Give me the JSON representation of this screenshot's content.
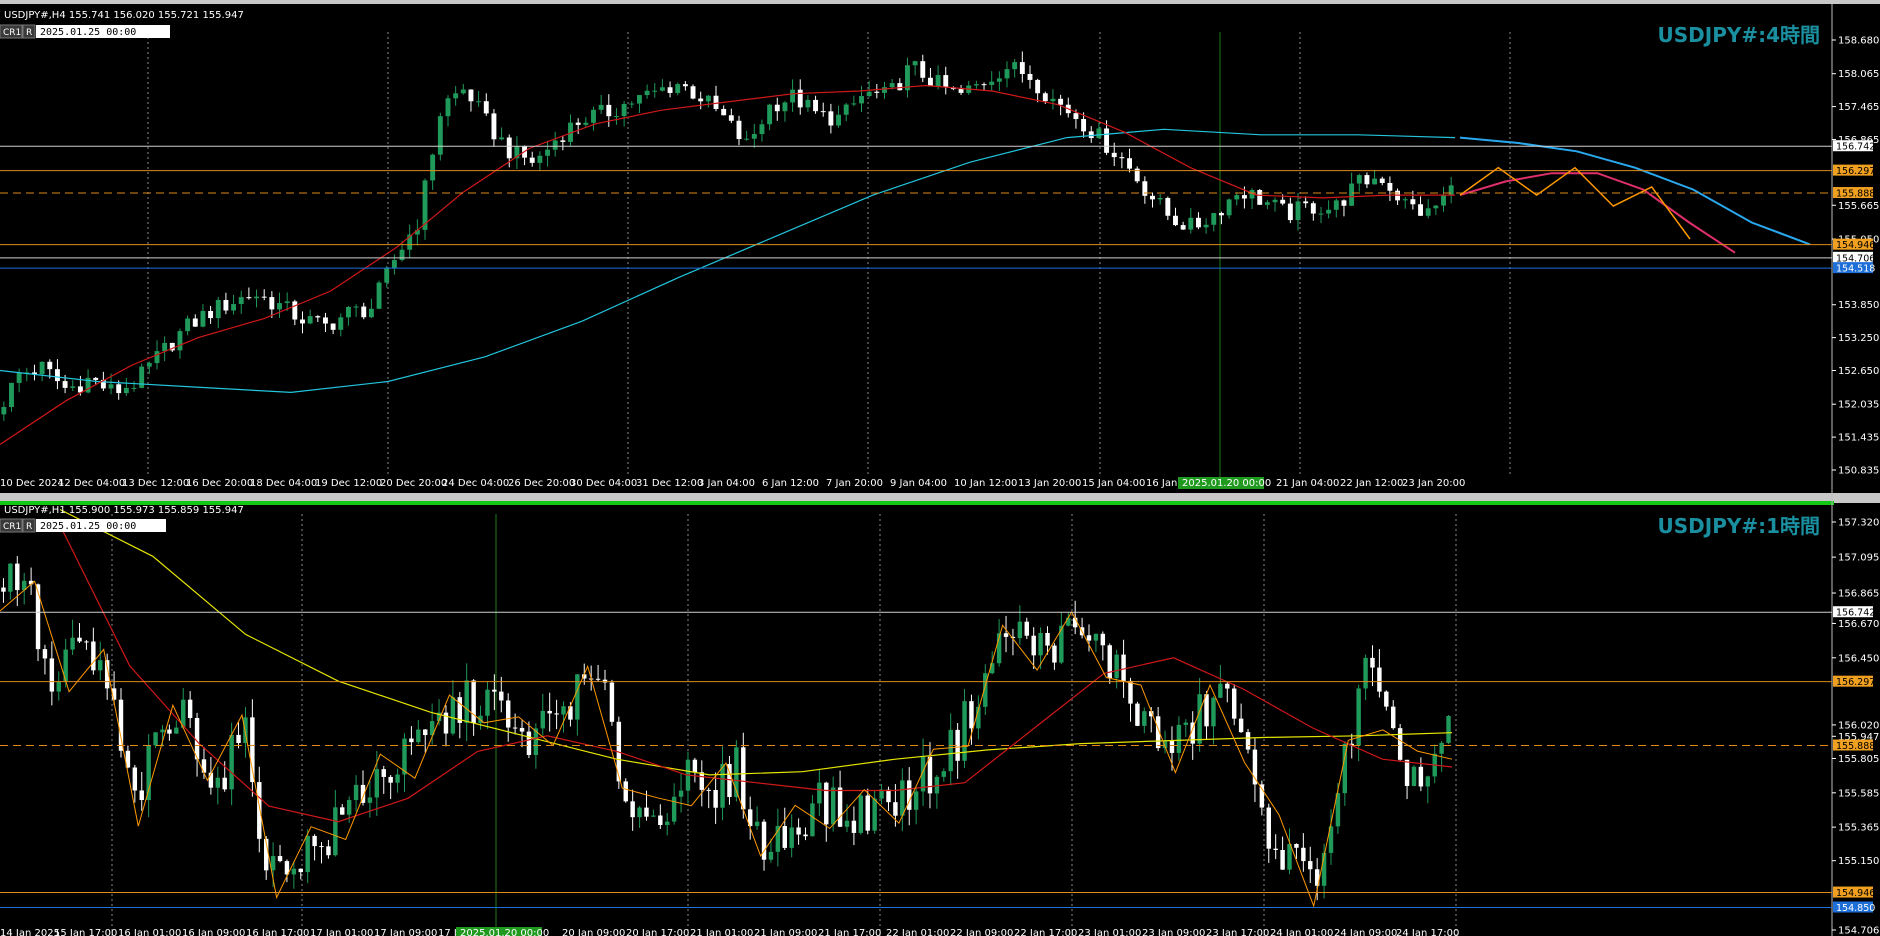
{
  "colors": {
    "bull": "#1f9a5b",
    "bear": "#ffffff",
    "ma_red": "#d01818",
    "ma_cyan": "#22c5dd",
    "ma_yellow": "#e6e600",
    "zigzag": "#ff9900",
    "orange_line": "#e08a1a",
    "white_line": "#d0d0d0",
    "blue_line": "#1e6fd8",
    "grid": "#8a8a8a",
    "pink_fc": "#e0306a",
    "blue_fc": "#2aa8ee",
    "watermark": "#1a8fa0"
  },
  "chart_data": [
    {
      "type": "candlestick",
      "panel": "top",
      "symbol_header": "USDJPY#,H4  155.741 156.020 155.721 155.947",
      "watermark": "USDJPY#:4時間",
      "badges": [
        "CR1",
        "R"
      ],
      "date_field": "2025.01.25 00:00",
      "y_ticks": [
        "158.680",
        "158.065",
        "157.465",
        "156.865",
        "156.742",
        "156.297",
        "155.888",
        "155.665",
        "155.050",
        "154.946",
        "154.706",
        "154.518",
        "153.850",
        "153.250",
        "152.650",
        "152.035",
        "151.435",
        "150.835"
      ],
      "ylim": [
        150.835,
        158.68
      ],
      "x_ticks": [
        "10 Dec 2024",
        "12 Dec 04:00",
        "13 Dec 12:00",
        "16 Dec 20:00",
        "18 Dec 04:00",
        "19 Dec 12:00",
        "20 Dec 20:00",
        "24 Dec 04:00",
        "26 Dec 20:00",
        "30 Dec 04:00",
        "31 Dec 12:00",
        "3 Jan 04:00",
        "6 Jan 12:00",
        "7 Jan 20:00",
        "9 Jan 04:00",
        "10 Jan 12:00",
        "13 Jan 20:00",
        "15 Jan 04:00",
        "16 Jan 1",
        "2025.01.20 00:00",
        "21 Jan 04:00",
        "22 Jan 12:00",
        "23 Jan 20:00"
      ],
      "hlines": [
        {
          "price": 156.742,
          "label": "156.742",
          "kind": "white"
        },
        {
          "price": 156.297,
          "label": "156.297",
          "kind": "orange"
        },
        {
          "price": 155.888,
          "label": "155.888",
          "kind": "orange_dashed"
        },
        {
          "price": 154.946,
          "label": "154.946",
          "kind": "orange"
        },
        {
          "price": 154.706,
          "label": "154.706",
          "kind": "white"
        },
        {
          "price": 154.518,
          "label": "154.518",
          "kind": "blue"
        }
      ],
      "close_path": [
        151.85,
        152.6,
        152.7,
        152.3,
        152.5,
        152.25,
        152.45,
        152.95,
        153.4,
        153.7,
        153.9,
        154.05,
        153.85,
        153.6,
        153.45,
        153.7,
        153.8,
        154.7,
        155.4,
        157.5,
        157.8,
        157.1,
        156.6,
        156.45,
        156.95,
        157.25,
        157.35,
        157.55,
        157.7,
        157.9,
        157.65,
        157.25,
        156.75,
        157.5,
        157.65,
        157.3,
        157.25,
        157.7,
        157.65,
        158.2,
        157.9,
        157.65,
        157.9,
        158.2,
        158.05,
        157.6,
        157.3,
        156.9,
        156.5,
        155.95,
        155.45,
        155.25,
        155.55,
        155.95,
        155.75,
        155.5,
        155.65,
        155.6,
        156.05,
        156.2,
        155.7,
        155.5,
        155.95
      ],
      "ma_red_path": [
        151.3,
        152.1,
        152.75,
        153.25,
        153.6,
        154.1,
        154.9,
        155.9,
        156.7,
        157.15,
        157.4,
        157.55,
        157.7,
        157.75,
        157.85,
        157.75,
        157.5,
        157.0,
        156.35,
        155.85,
        155.8,
        155.85,
        155.85
      ],
      "ma_cyan_path": [
        152.65,
        152.45,
        152.35,
        152.25,
        152.45,
        152.9,
        153.55,
        154.35,
        155.1,
        155.85,
        156.45,
        156.9,
        157.05,
        156.95,
        156.95,
        156.9
      ],
      "forecast_zigzag": [
        155.85,
        156.35,
        155.85,
        156.35,
        155.65,
        156.0,
        155.05
      ],
      "forecast_pink": [
        155.85,
        156.1,
        156.25,
        156.25,
        155.95,
        155.35,
        154.8
      ],
      "forecast_blue": [
        156.9,
        156.8,
        156.65,
        156.35,
        155.95,
        155.35,
        154.95
      ]
    },
    {
      "type": "candlestick",
      "panel": "bottom",
      "symbol_header": "USDJPY#,H1  155.900 155.973 155.859 155.947",
      "watermark": "USDJPY#:1時間",
      "badges": [
        "CR1",
        "R"
      ],
      "date_field": "2025.01.25 00:00",
      "y_ticks": [
        "157.320",
        "157.095",
        "156.865",
        "156.742",
        "156.670",
        "156.450",
        "156.297",
        "156.020",
        "155.947",
        "155.888",
        "155.805",
        "155.585",
        "155.365",
        "155.150",
        "154.946",
        "154.850",
        "154.706"
      ],
      "ylim": [
        154.706,
        157.32
      ],
      "x_ticks": [
        "14 Jan 2025",
        "15 Jan 17:00",
        "16 Jan 01:00",
        "16 Jan 09:00",
        "16 Jan 17:00",
        "17 Jan 01:00",
        "17 Jan 09:00",
        "17 J",
        "2025.01.20 00:00",
        "20 Jan 09:00",
        "20 Jan 17:00",
        "21 Jan 01:00",
        "21 Jan 09:00",
        "21 Jan 17:00",
        "22 Jan 01:00",
        "22 Jan 09:00",
        "22 Jan 17:00",
        "23 Jan 01:00",
        "23 Jan 09:00",
        "23 Jan 17:00",
        "24 Jan 01:00",
        "24 Jan 09:00",
        "24 Jan 17:00"
      ],
      "hlines": [
        {
          "price": 156.742,
          "label": "156.742",
          "kind": "white"
        },
        {
          "price": 156.297,
          "label": "156.297",
          "kind": "orange"
        },
        {
          "price": 155.888,
          "label": "155.888",
          "kind": "orange_dashed"
        },
        {
          "price": 154.946,
          "label": "154.946",
          "kind": "orange"
        },
        {
          "price": 154.85,
          "label": "154.850",
          "kind": "blue"
        }
      ],
      "close_path": [
        156.9,
        157.0,
        156.2,
        156.55,
        156.3,
        155.5,
        155.95,
        156.1,
        155.6,
        156.0,
        155.05,
        155.2,
        155.25,
        155.55,
        155.7,
        155.8,
        156.0,
        156.15,
        156.2,
        155.9,
        156.0,
        156.2,
        156.3,
        155.55,
        155.4,
        155.7,
        155.5,
        155.75,
        155.2,
        155.35,
        155.55,
        155.4,
        155.5,
        155.55,
        155.7,
        155.9,
        156.3,
        156.65,
        156.5,
        156.6,
        156.55,
        156.35,
        156.0,
        155.85,
        156.1,
        156.25,
        155.5,
        155.2,
        155.0,
        155.6,
        156.4,
        155.85,
        155.65,
        155.95
      ],
      "ma_red_path": [
        157.3,
        156.4,
        155.9,
        155.5,
        155.4,
        155.55,
        155.85,
        155.95,
        155.85,
        155.7,
        155.65,
        155.6,
        155.6,
        155.65,
        156.0,
        156.35,
        156.45,
        156.25,
        156.0,
        155.8,
        155.75
      ],
      "ma_yellow_path": [
        157.4,
        157.1,
        156.6,
        156.3,
        156.1,
        155.95,
        155.8,
        155.7,
        155.72,
        155.8,
        155.86,
        155.9,
        155.92,
        155.94,
        155.95,
        155.97
      ]
    }
  ]
}
